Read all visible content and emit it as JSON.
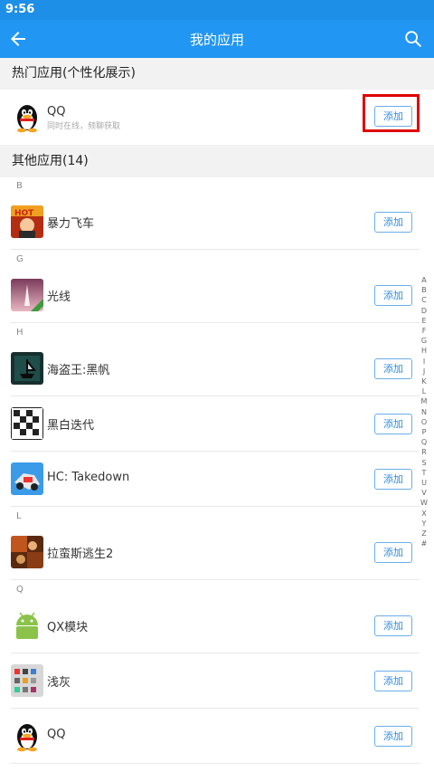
{
  "status": {
    "time": "9:56"
  },
  "header": {
    "title": "我的应用",
    "back_icon": "arrow-left-icon",
    "search_icon": "search-icon"
  },
  "hot_section": {
    "title": "热门应用(个性化展示)",
    "app": {
      "name": "QQ",
      "subtitle": "同时在线，频聊获取",
      "button": "添加"
    }
  },
  "other_section": {
    "title": "其他应用(14)",
    "groups": [
      {
        "letter": "B",
        "apps": [
          {
            "name": "暴力飞车",
            "button": "添加"
          }
        ]
      },
      {
        "letter": "G",
        "apps": [
          {
            "name": "光线",
            "button": "添加"
          }
        ]
      },
      {
        "letter": "H",
        "apps": [
          {
            "name": "海盗王:黑帆",
            "button": "添加"
          },
          {
            "name": "黑白迭代",
            "button": "添加"
          },
          {
            "name": "HC: Takedown",
            "button": "添加"
          }
        ]
      },
      {
        "letter": "L",
        "apps": [
          {
            "name": "拉蛮斯逃生2",
            "button": "添加"
          }
        ]
      },
      {
        "letter": "Q",
        "apps": [
          {
            "name": "QX模块",
            "button": "添加"
          },
          {
            "name": "浅灰",
            "button": "添加"
          },
          {
            "name": "QQ",
            "button": "添加"
          }
        ]
      }
    ]
  },
  "index_letters": [
    "A",
    "B",
    "C",
    "D",
    "E",
    "F",
    "G",
    "H",
    "I",
    "J",
    "K",
    "L",
    "M",
    "N",
    "O",
    "P",
    "Q",
    "R",
    "S",
    "T",
    "U",
    "V",
    "W",
    "X",
    "Y",
    "Z",
    "#"
  ],
  "colors": {
    "appbar": "#2196f3",
    "statusbar": "#1e8fe6",
    "button_text": "#2f8ae0",
    "highlight": "#e00000"
  }
}
